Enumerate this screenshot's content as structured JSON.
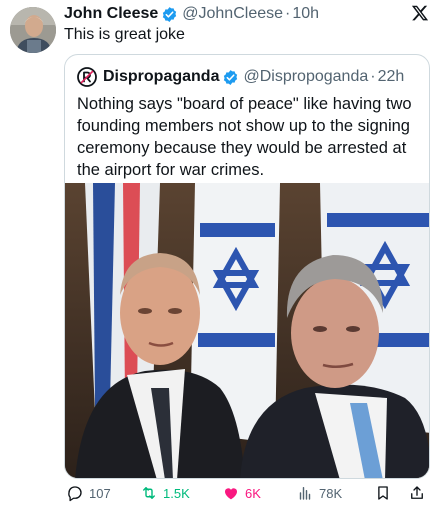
{
  "tweet": {
    "author_name": "John Cleese",
    "author_handle": "@JohnCleese",
    "separator": "·",
    "time": "10h",
    "text": "This is great joke",
    "avatar_icon": "user-photo-avatar",
    "verified_icon": "verified-badge-icon",
    "platform_icon": "x-logo-icon"
  },
  "quote": {
    "author_name": "Dispropaganda",
    "author_handle": "@Dispropoganda",
    "separator": "·",
    "time": "22h",
    "text": "Nothing says \"board of peace\" like having two founding members not show up to the signing ceremony because they would be arrested at the airport for war crimes.",
    "avatar_icon": "registered-mark-avatar"
  },
  "actions": {
    "replies": "107",
    "retweets": "1.5K",
    "likes": "6K",
    "views": "78K"
  },
  "colors": {
    "text": "#0f1419",
    "secondary": "#536471",
    "verified": "#1d9bf0",
    "retweet": "#00ba7c",
    "like": "#f91880",
    "border": "#cfd9de"
  }
}
